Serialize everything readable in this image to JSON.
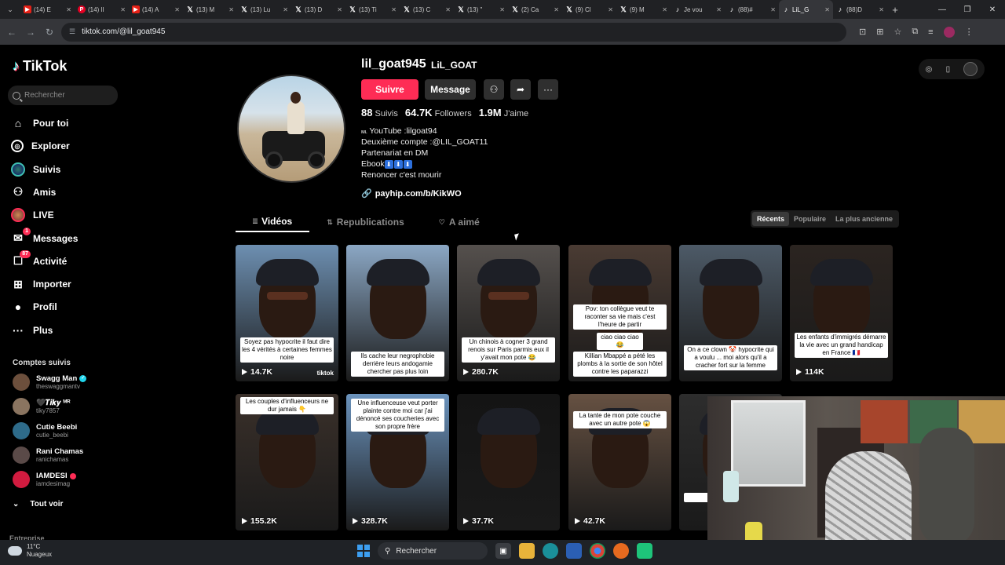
{
  "browser": {
    "tabs": [
      {
        "icon": "youtube-icon",
        "label": "(14) E"
      },
      {
        "icon": "pinterest-icon",
        "label": "(14) Il"
      },
      {
        "icon": "youtube-icon",
        "label": "(14) A"
      },
      {
        "icon": "x-icon",
        "label": "(13) M"
      },
      {
        "icon": "x-icon",
        "label": "(13) Lu"
      },
      {
        "icon": "x-icon",
        "label": "(13) D"
      },
      {
        "icon": "x-icon",
        "label": "(13) Ti"
      },
      {
        "icon": "x-icon",
        "label": "(13) C"
      },
      {
        "icon": "x-icon",
        "label": "(13) \""
      },
      {
        "icon": "x-icon",
        "label": "(2) Ca"
      },
      {
        "icon": "x-icon",
        "label": "(9) Cl"
      },
      {
        "icon": "x-icon",
        "label": "(9) M"
      },
      {
        "icon": "tiktok-icon",
        "label": "Je vou"
      },
      {
        "icon": "tiktok-icon",
        "label": "(88)#"
      },
      {
        "icon": "tiktok-icon",
        "label": "LiL_G"
      },
      {
        "icon": "tiktok-icon",
        "label": "(88)D"
      }
    ],
    "active_tab": 14,
    "url": "tiktok.com/@lil_goat945"
  },
  "sidebar": {
    "logo": "TikTok",
    "search_placeholder": "Rechercher",
    "nav": [
      {
        "label": "Pour toi",
        "icon": "home-icon"
      },
      {
        "label": "Explorer",
        "icon": "compass-icon"
      },
      {
        "label": "Suivis",
        "icon": "avatar-icon"
      },
      {
        "label": "Amis",
        "icon": "friends-icon"
      },
      {
        "label": "LIVE",
        "icon": "live-icon"
      },
      {
        "label": "Messages",
        "icon": "messages-icon",
        "badge": "1"
      },
      {
        "label": "Activité",
        "icon": "activity-icon",
        "badge": "87"
      },
      {
        "label": "Importer",
        "icon": "upload-icon"
      },
      {
        "label": "Profil",
        "icon": "profile-icon"
      },
      {
        "label": "Plus",
        "icon": "more-icon"
      }
    ],
    "following_title": "Comptes suivis",
    "following": [
      {
        "name": "Swagg Man",
        "handle": "theswaggmantv",
        "verified": true
      },
      {
        "name": "🖤𝑻𝒊𝒌𝒚 ᴹᴿ",
        "handle": "tiky7857"
      },
      {
        "name": "Cutie Beebi",
        "handle": "cutie_beebi"
      },
      {
        "name": "Rani Chamas",
        "handle": "ranichamas"
      },
      {
        "name": "IAMDESI",
        "handle": "iamdesimag",
        "live_badge": true
      }
    ],
    "see_all": "Tout voir",
    "enterprise": "Entreprise"
  },
  "profile": {
    "username": "lil_goat945",
    "display_name": "LiL_GOAT",
    "follow_label": "Suivre",
    "message_label": "Message",
    "stats": [
      {
        "value": "88",
        "label": "Suivis"
      },
      {
        "value": "64.7K",
        "label": "Followers"
      },
      {
        "value": "1.9M",
        "label": "J'aime"
      }
    ],
    "bio": {
      "line1_prefix": "ᴍʟ",
      "line1": "YouTube :lilgoat94",
      "line2": "Deuxième compte :@LIL_GOAT11",
      "line3": "Partenariat en DM",
      "line4_text": "Ebook",
      "line4_emojis": [
        "⬇",
        "⬇",
        "⬇"
      ],
      "line5": "Renoncer c'est mourir"
    },
    "link": "payhip.com/b/KikWO"
  },
  "content_tabs": [
    {
      "label": "Vidéos",
      "icon": "grid-icon",
      "active": true
    },
    {
      "label": "Republications",
      "icon": "repost-icon"
    },
    {
      "label": "A aimé",
      "icon": "heart-lock-icon"
    }
  ],
  "sort": {
    "options": [
      "Récents",
      "Populaire",
      "La plus ancienne"
    ],
    "selected": "Récents"
  },
  "videos": [
    {
      "caption": "Soyez pas hypocrite il faut dire les 4 vérités à certaines femmes noire",
      "views": "14.7K",
      "watermark": "tiktok",
      "bg": "#6d8fb1"
    },
    {
      "caption": "Ils cache leur negrophobie derrière leurs andogamie chercher pas plus loin",
      "views": "",
      "bg": "#8ba7c4"
    },
    {
      "caption": "Un chinois à cogner 3 grand renois sur Paris parmis eux il y'avait mon pote 😂",
      "views": "280.7K",
      "bg": "#55504d"
    },
    {
      "caption": "Pov: ton collègue veut te raconter sa vie mais c'est l'heure de partir",
      "caption2": "ciao ciao ciao 😂",
      "caption3": "Killian Mbappé a pété les plombs à la sortie de son hôtel contre les paparazzi",
      "views": "",
      "bg": "#4a3b33"
    },
    {
      "caption": "On a ce clown 🤡 hypocrite qui a voulu ... moi alors qu'il a cracher fort sur la femme",
      "views": "",
      "bg": "#4d5a67"
    },
    {
      "caption": "Les enfants d'immigrés démarre la vie avec un grand handicap en France 🇫🇷",
      "views": "114K",
      "bg": "#2b2420"
    },
    {
      "caption": "Les couples d'influenceurs ne dur jamais 👇",
      "views": "155.2K",
      "bg": "#3a302a"
    },
    {
      "caption": "Une influenceuse veut porter plainte contre moi car j'ai dénoncé ses coucheries avec son propre frère",
      "views": "328.7K",
      "bg": "#6b93bd"
    },
    {
      "caption": "",
      "views": "37.7K",
      "bg": "#141414"
    },
    {
      "caption": "La tante de mon pote couche avec un autre pote 😱",
      "views": "42.7K",
      "bg": "#665142"
    },
    {
      "caption": "Il app ... ces pr",
      "views": "",
      "bg": "#2d2d2d"
    }
  ],
  "taskbar": {
    "temp": "11°C",
    "weather": "Nuageux",
    "search_placeholder": "Rechercher"
  },
  "colors": {
    "accent": "#fe2c55",
    "background": "#000000",
    "panel": "#2f2f2f"
  }
}
